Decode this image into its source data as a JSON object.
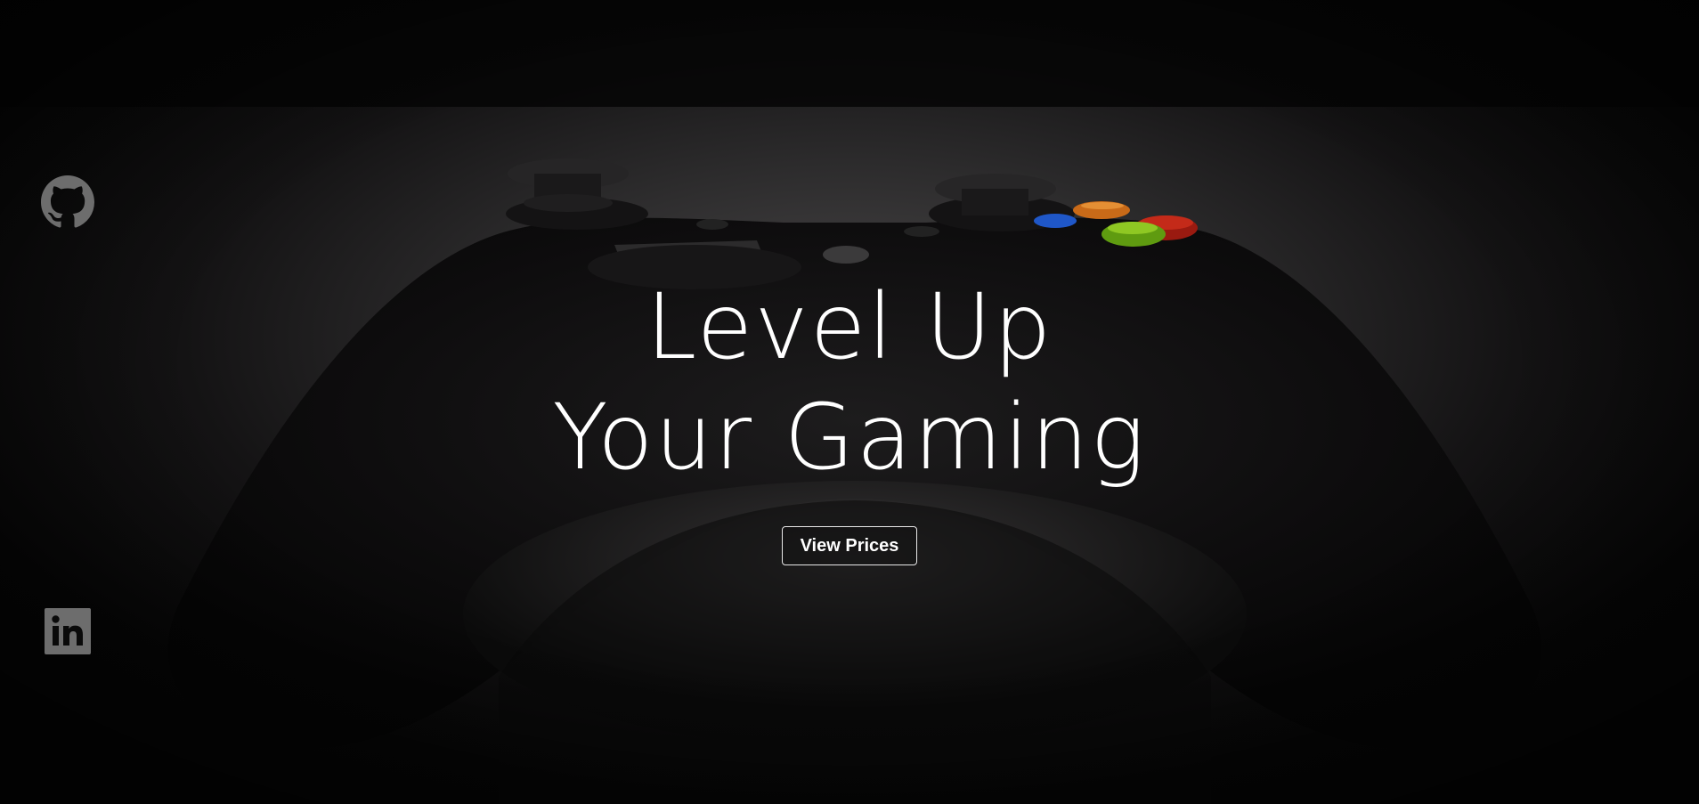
{
  "hero": {
    "headline_line1": "Level Up",
    "headline_line2": "Your Gaming",
    "cta_label": "View Prices"
  },
  "social": {
    "github_icon": "github-icon",
    "linkedin_icon": "linkedin-icon",
    "icon_color": "#6d6d6d"
  },
  "colors": {
    "text": "#ffffff",
    "button_border": "#e8e8e8",
    "background": "#060606"
  }
}
